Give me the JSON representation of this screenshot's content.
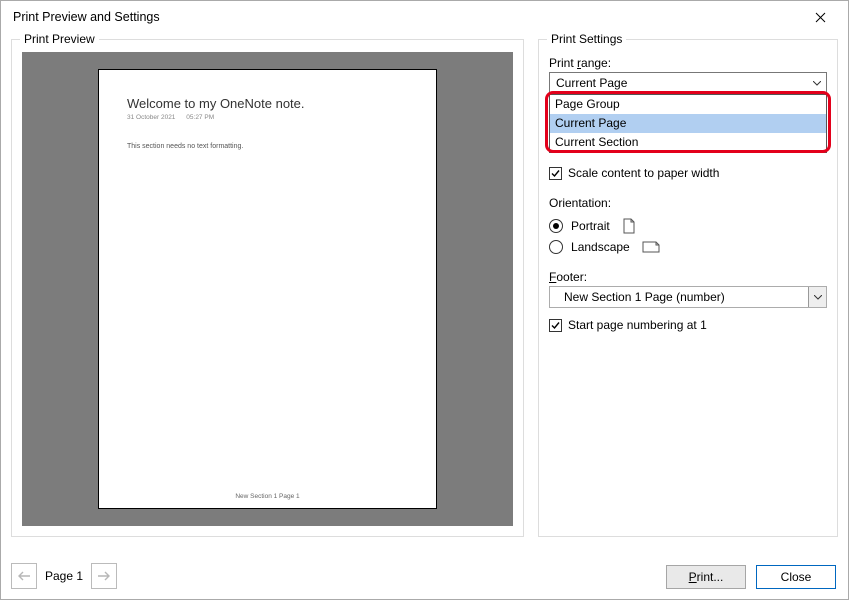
{
  "titlebar": {
    "title": "Print Preview and Settings"
  },
  "preview": {
    "legend": "Print Preview",
    "page_title": "Welcome to my OneNote note.",
    "page_date": "31 October 2021",
    "page_time": "05:27 PM",
    "page_body": "This section needs no text formatting.",
    "page_footer": "New Section 1 Page 1"
  },
  "pager": {
    "label": "Page 1"
  },
  "settings": {
    "legend": "Print Settings",
    "range_label_pre": "Print ",
    "range_label_ul": "r",
    "range_label_post": "ange:",
    "range_selected": "Current Page",
    "range_options": [
      "Page Group",
      "Current Page",
      "Current Section"
    ],
    "scale_pre": "",
    "scale_ul": "S",
    "scale_post": "cale content to paper width",
    "orientation_label": "Orientation:",
    "portrait_ul": "P",
    "portrait_post": "ortrait",
    "landscape_ul": "L",
    "landscape_post": "andscape",
    "footer_ul": "F",
    "footer_post": "ooter:",
    "footer_selected": "New Section 1 Page (number)",
    "startnum_text": "Start page numbering at 1"
  },
  "buttons": {
    "print": "Print...",
    "close": "Close"
  }
}
